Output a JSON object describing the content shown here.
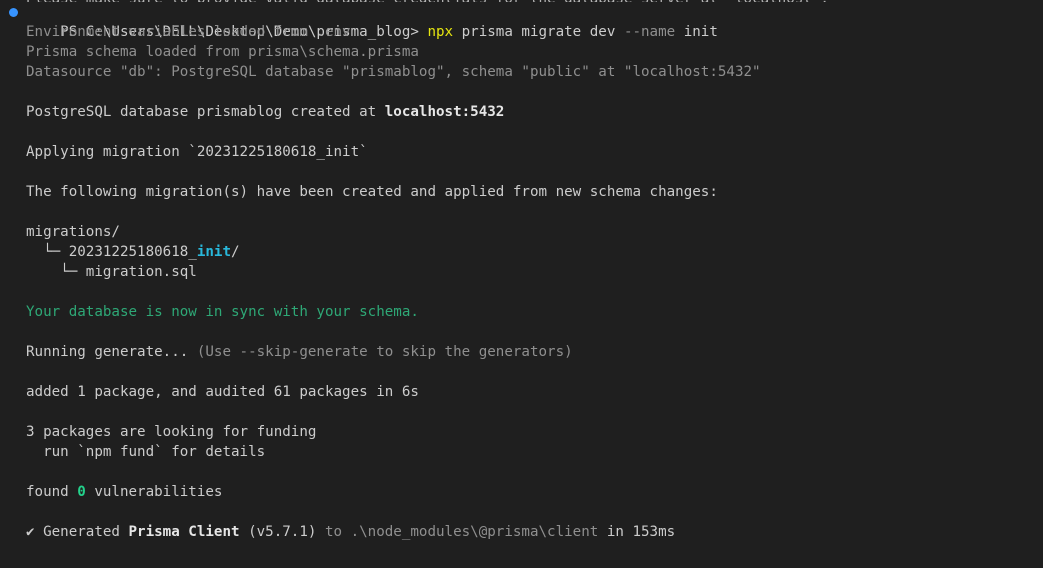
{
  "terminal": {
    "cut_line": "Please make sure to provide valid database credentials for the database server at `localhost`.",
    "prompt": {
      "prefix": "PS C:\\Users\\DELL\\Desktop\\Demo\\prisma_blog> ",
      "cmd": "npx",
      "args1": " prisma migrate dev ",
      "flag": "--name",
      "args2": " init"
    },
    "env_line": "Environment variables loaded from .env",
    "schema_line": "Prisma schema loaded from prisma\\schema.prisma",
    "datasource_line": "Datasource \"db\": PostgreSQL database \"prismablog\", schema \"public\" at \"localhost:5432\"",
    "created": {
      "text": "PostgreSQL database prismablog created at ",
      "host": "localhost:5432"
    },
    "applying_line": "Applying migration `20231225180618_init`",
    "following_line": "The following migration(s) have been created and applied from new schema changes:",
    "tree": {
      "root": "migrations/",
      "folder_prefix": "  └─ 20231225180618_",
      "folder_highlight": "init",
      "folder_suffix": "/",
      "file": "    └─ migration.sql"
    },
    "sync_line": "Your database is now in sync with your schema.",
    "generate": {
      "text": "Running generate... ",
      "hint": "(Use --skip-generate to skip the generators)"
    },
    "added_line": "added 1 package, and audited 61 packages in 6s",
    "funding_line": "3 packages are looking for funding",
    "fund_hint_line": "  run `npm fund` for details",
    "found": {
      "prefix": "found ",
      "count": "0",
      "suffix": " vulnerabilities"
    },
    "generated": {
      "check": "✔",
      "text1": "Generated ",
      "product": "Prisma Client",
      "version": " (v5.7.1)",
      "to": " to .\\node_modules\\@prisma\\client",
      "time": " in 153ms"
    }
  },
  "colors": {
    "background": "#1f1f1f",
    "foreground": "#cccccc",
    "dim": "#8f8f8f",
    "command": "#e5e510",
    "success": "#23d18b",
    "highlight": "#29b8db",
    "prompt_dot": "#3794ff"
  }
}
